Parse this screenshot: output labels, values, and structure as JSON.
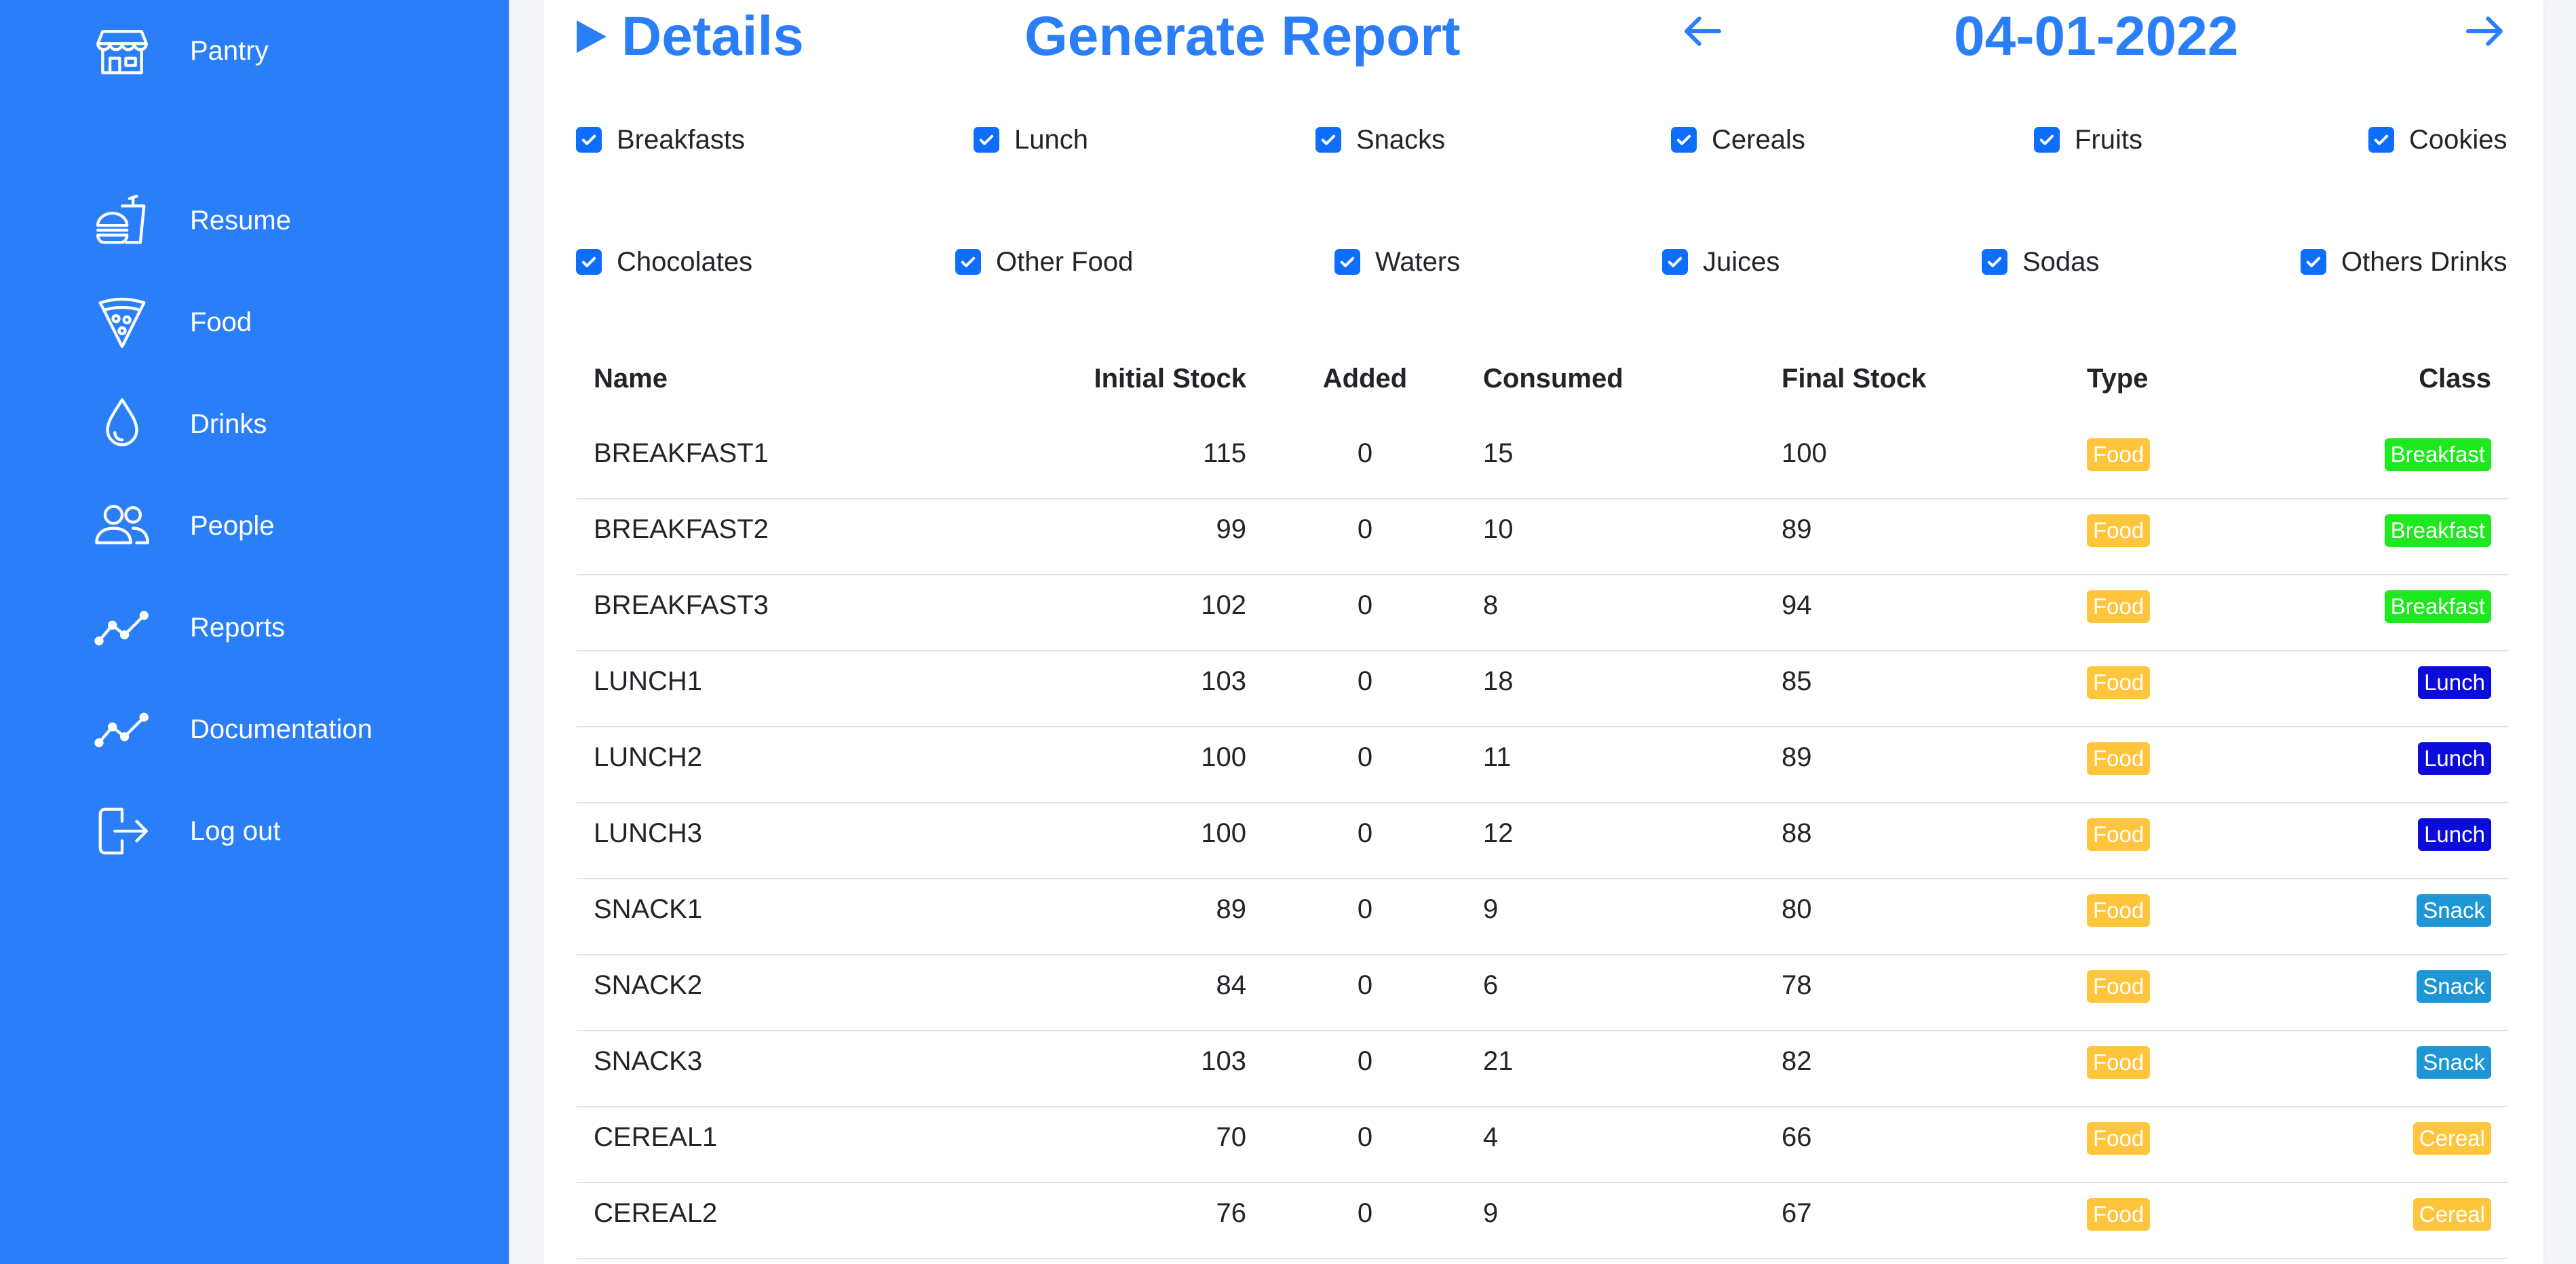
{
  "sidebar": {
    "items": [
      {
        "label": "Pantry",
        "icon": "store-icon"
      },
      {
        "label": "Resume",
        "icon": "fast-food-icon"
      },
      {
        "label": "Food",
        "icon": "pizza-icon"
      },
      {
        "label": "Drinks",
        "icon": "droplet-icon"
      },
      {
        "label": "People",
        "icon": "people-icon"
      },
      {
        "label": "Reports",
        "icon": "trend-line-icon"
      },
      {
        "label": "Documentation",
        "icon": "trend-line-icon"
      },
      {
        "label": "Log out",
        "icon": "logout-icon"
      }
    ]
  },
  "header": {
    "details": "Details",
    "generate_report": "Generate Report",
    "date": "04-01-2022"
  },
  "filters": {
    "row1": [
      "Breakfasts",
      "Lunch",
      "Snacks",
      "Cereals",
      "Fruits",
      "Cookies"
    ],
    "row2": [
      "Chocolates",
      "Other Food",
      "Waters",
      "Juices",
      "Sodas",
      "Others Drinks"
    ]
  },
  "table": {
    "headers": [
      "Name",
      "Initial Stock",
      "Added",
      "Consumed",
      "Final Stock",
      "Type",
      "Class"
    ],
    "rows": [
      {
        "name": "BREAKFAST1",
        "initial": "115",
        "added": "0",
        "consumed": "15",
        "final": "100",
        "type": "Food",
        "class": "Breakfast"
      },
      {
        "name": "BREAKFAST2",
        "initial": "99",
        "added": "0",
        "consumed": "10",
        "final": "89",
        "type": "Food",
        "class": "Breakfast"
      },
      {
        "name": "BREAKFAST3",
        "initial": "102",
        "added": "0",
        "consumed": "8",
        "final": "94",
        "type": "Food",
        "class": "Breakfast"
      },
      {
        "name": "LUNCH1",
        "initial": "103",
        "added": "0",
        "consumed": "18",
        "final": "85",
        "type": "Food",
        "class": "Lunch"
      },
      {
        "name": "LUNCH2",
        "initial": "100",
        "added": "0",
        "consumed": "11",
        "final": "89",
        "type": "Food",
        "class": "Lunch"
      },
      {
        "name": "LUNCH3",
        "initial": "100",
        "added": "0",
        "consumed": "12",
        "final": "88",
        "type": "Food",
        "class": "Lunch"
      },
      {
        "name": "SNACK1",
        "initial": "89",
        "added": "0",
        "consumed": "9",
        "final": "80",
        "type": "Food",
        "class": "Snack"
      },
      {
        "name": "SNACK2",
        "initial": "84",
        "added": "0",
        "consumed": "6",
        "final": "78",
        "type": "Food",
        "class": "Snack"
      },
      {
        "name": "SNACK3",
        "initial": "103",
        "added": "0",
        "consumed": "21",
        "final": "82",
        "type": "Food",
        "class": "Snack"
      },
      {
        "name": "CEREAL1",
        "initial": "70",
        "added": "0",
        "consumed": "4",
        "final": "66",
        "type": "Food",
        "class": "Cereal"
      },
      {
        "name": "CEREAL2",
        "initial": "76",
        "added": "0",
        "consumed": "9",
        "final": "67",
        "type": "Food",
        "class": "Cereal"
      }
    ]
  },
  "colors": {
    "brand": "#2a7ff9",
    "checkbox": "#0d6efd",
    "food_badge": "#ffc53d",
    "class_badges": {
      "Breakfast": "#1ee81e",
      "Lunch": "#0b0bdc",
      "Snack": "#1e96d6",
      "Cereal": "#ffc53d"
    }
  }
}
